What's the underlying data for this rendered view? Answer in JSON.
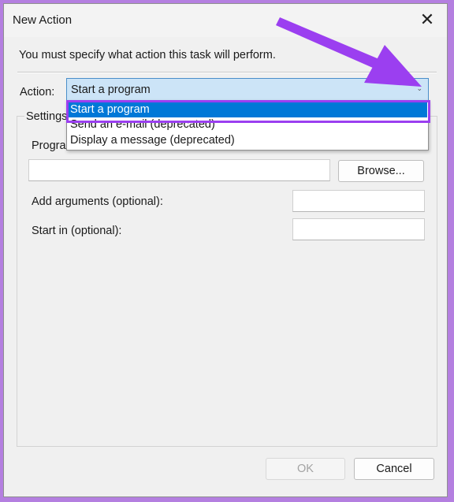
{
  "dialog": {
    "title": "New Action",
    "close_glyph": "✕",
    "instruction": "You must specify what action this task will perform."
  },
  "action": {
    "label": "Action:",
    "selected": "Start a program",
    "dropdown_arrow": "⌄",
    "options": [
      "Start a program",
      "Send an e-mail (deprecated)",
      "Display a message (deprecated)"
    ]
  },
  "settings": {
    "legend": "Settings",
    "program_label": "Program/script:",
    "program_label_visible": "Progra",
    "program_value": "",
    "browse_label": "Browse...",
    "args_label": "Add arguments (optional):",
    "args_value": "",
    "start_label": "Start in (optional):",
    "start_value": ""
  },
  "footer": {
    "ok_label": "OK",
    "cancel_label": "Cancel"
  },
  "annotation": {
    "arrow_color": "#9b3ff0",
    "highlight_color": "#9b3ff0"
  },
  "icons": {
    "close": "close-icon",
    "dropdown": "chevron-down-icon"
  }
}
